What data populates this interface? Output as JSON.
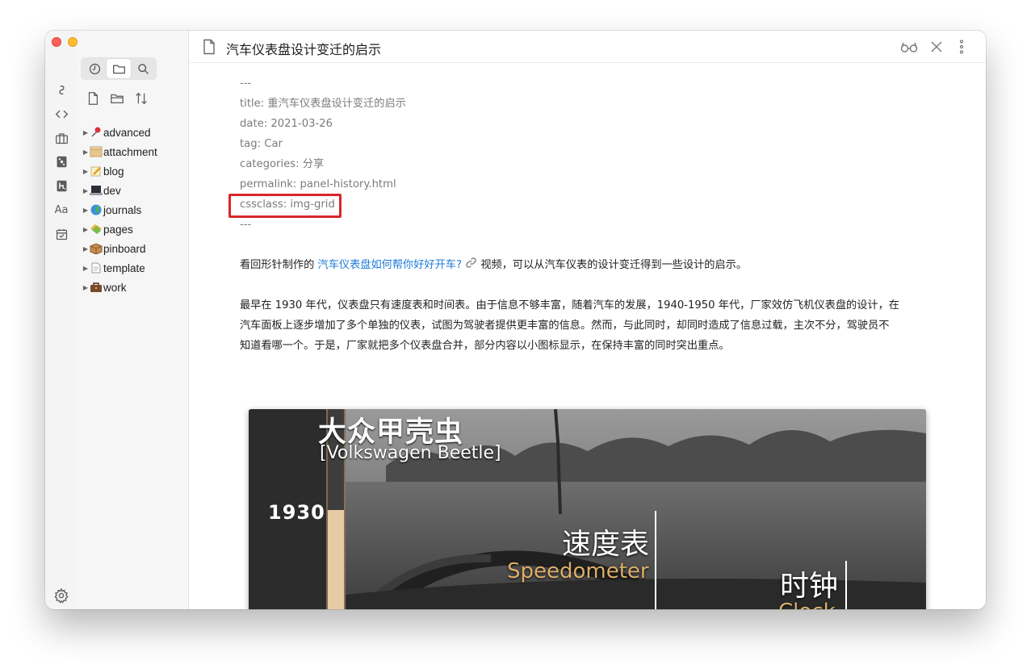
{
  "window": {
    "title": "汽车仪表盘设计变迁的启示"
  },
  "ribbon": {
    "icons": [
      "link-icon",
      "code-icon",
      "briefcase-icon",
      "dice-icon",
      "heading-icon",
      "font-icon",
      "calendar-icon"
    ],
    "font_label": "Aa",
    "settings_icon": "gear-icon"
  },
  "explorer": {
    "tabs": [
      {
        "name": "recent-files-tab",
        "icon": "clock-icon"
      },
      {
        "name": "file-explorer-tab",
        "icon": "folder-icon",
        "active": true
      },
      {
        "name": "search-tab",
        "icon": "search-icon"
      }
    ],
    "actions": [
      "new-note-icon",
      "new-folder-icon",
      "sort-icon"
    ],
    "folders": [
      {
        "label": "advanced",
        "emoji": "pushpin"
      },
      {
        "label": "attachment",
        "emoji": "box"
      },
      {
        "label": "blog",
        "emoji": "memo"
      },
      {
        "label": "dev",
        "emoji": "laptop"
      },
      {
        "label": "journals",
        "emoji": "globe"
      },
      {
        "label": "pages",
        "emoji": "tag"
      },
      {
        "label": "pinboard",
        "emoji": "package"
      },
      {
        "label": "template",
        "emoji": "page"
      },
      {
        "label": "work",
        "emoji": "briefcase"
      }
    ]
  },
  "doc": {
    "title": "汽车仪表盘设计变迁的启示",
    "frontmatter": [
      "---",
      "title: 重汽车仪表盘设计变迁的启示",
      "date: 2021-03-26",
      "tag: Car",
      "categories: 分享",
      "permalink: panel-history.html",
      "cssclass: img-grid",
      "---"
    ],
    "para1_before": "看回形针制作的 ",
    "para1_link": "汽车仪表盘如何帮你好好开车?",
    "para1_after": " 视频，可以从汽车仪表的设计变迁得到一些设计的启示。",
    "para2_lines": [
      "最早在 1930 年代，仪表盘只有速度表和时间表。由于信息不够丰富，随着汽车的发展，1940-1950 年代，厂家效仿飞机仪表盘的设计，在",
      "汽车面板上逐步增加了多个单独的仪表，试图为驾驶者提供更丰富的信息。然而，与此同时，却同时造成了信息过载，主次不分，驾驶员不",
      "知道看哪一个。于是，厂家就把多个仪表盘合并，部分内容以小图标显示，在保持丰富的同时突出重点。"
    ]
  },
  "photo": {
    "caption_cn": "大众甲壳虫",
    "caption_en": "[Volkswagen Beetle]",
    "year": "1930",
    "speedometer_cn": "速度表",
    "speedometer_en": "Speedometer",
    "clock_cn": "时钟",
    "clock_en": "Clock"
  },
  "toolbar": {
    "icons": [
      "reading-glasses-icon",
      "close-icon",
      "more-options-icon"
    ]
  },
  "colors": {
    "link": "#1e7bd8",
    "highlight": "#d9262a",
    "label_en": "#dcae6a"
  }
}
